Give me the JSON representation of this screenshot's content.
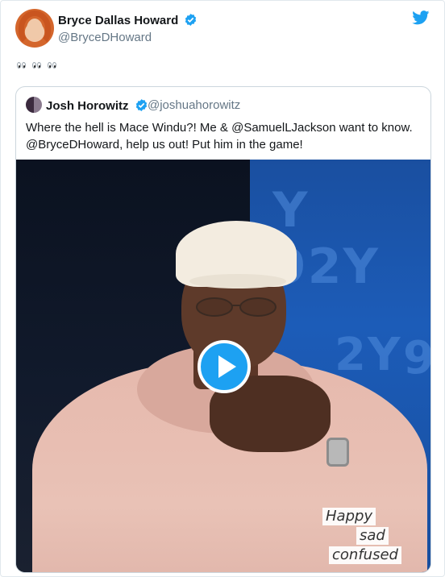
{
  "tweet": {
    "author": {
      "name": "Bryce Dallas Howard",
      "handle": "@BryceDHoward"
    },
    "text_icons": [
      "eyes-emoji",
      "eyes-emoji",
      "eyes-emoji"
    ]
  },
  "quoted": {
    "author": {
      "name": "Josh Horowitz",
      "handle": "@joshuahorowitz"
    },
    "text_lines": [
      "Where the hell is Mace Windu?! Me & @SamuelLJackson want to know.",
      "@BryceDHoward, help us out! Put him in the game!"
    ],
    "video": {
      "background_text": [
        "Y 92Y",
        "2Y",
        "9"
      ],
      "overlay_lines": [
        "Happy",
        "sad",
        "confused"
      ]
    }
  },
  "colors": {
    "accent": "#1da1f2",
    "text": "#14171a",
    "secondary": "#657786",
    "border": "#ccd6dd"
  }
}
